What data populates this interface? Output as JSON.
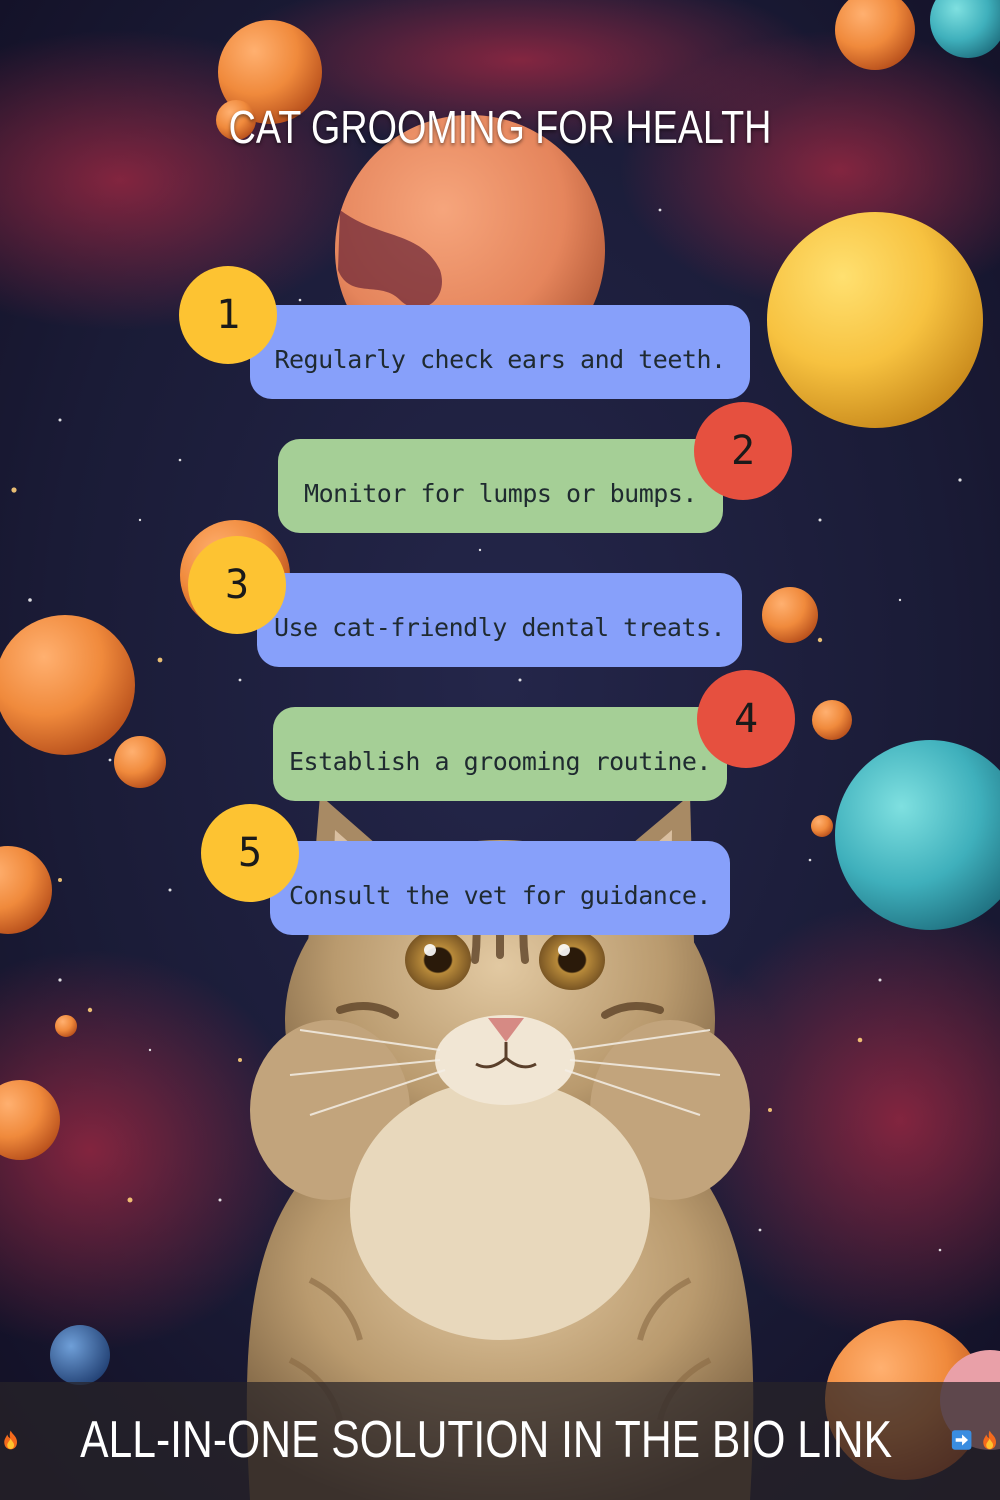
{
  "title": "CAT GROOMING FOR HEALTH",
  "colors": {
    "space_bg": "#1b1d3a",
    "nebula": "#8a1f34",
    "card_blue": "#87a0fa",
    "card_green": "#a5cf96",
    "badge_yellow": "#fdc332",
    "badge_red": "#e6503f"
  },
  "steps": [
    {
      "number": "1",
      "text": "Regularly check ears and teeth."
    },
    {
      "number": "2",
      "text": "Monitor for lumps or bumps."
    },
    {
      "number": "3",
      "text": "Use cat-friendly dental treats."
    },
    {
      "number": "4",
      "text": "Establish a grooming routine."
    },
    {
      "number": "5",
      "text": "Consult the vet for guidance."
    }
  ],
  "banner": {
    "text": "ALL-IN-ONE SOLUTION IN THE BIO LINK",
    "icons": [
      "fire-icon",
      "arrow-right-icon",
      "fire-icon"
    ]
  },
  "illustration": {
    "subject": "tabby-cat",
    "background": "space-with-planets"
  }
}
